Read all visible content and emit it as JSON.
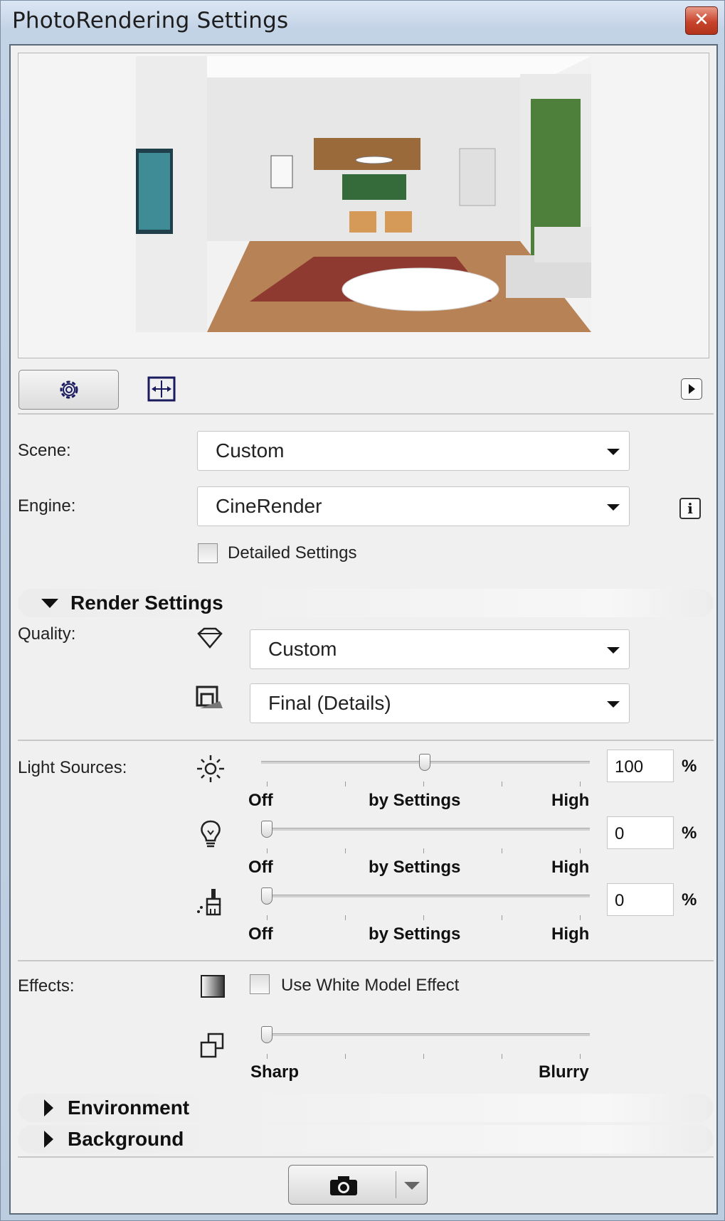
{
  "window": {
    "title": "PhotoRendering Settings",
    "close_icon": "close-icon"
  },
  "toolbar": {
    "settings_tab_icon": "gear-icon",
    "size_tab_icon": "size-dimension-icon",
    "menu_icon": "right-arrow-icon"
  },
  "scene": {
    "label": "Scene:",
    "value": "Custom"
  },
  "engine": {
    "label": "Engine:",
    "value": "CineRender",
    "info_icon": "info-icon"
  },
  "detailed_settings": {
    "label": "Detailed Settings",
    "checked": false
  },
  "render_settings": {
    "header": "Render Settings",
    "quality_label": "Quality:",
    "quality_value": "Custom",
    "detail_value": "Final (Details)"
  },
  "light_sources": {
    "label": "Light Sources:",
    "sliders": [
      {
        "icon": "sun-icon",
        "value": "100",
        "unit": "%",
        "level": 0.5,
        "min_label": "Off",
        "mid_label": "by Settings",
        "max_label": "High"
      },
      {
        "icon": "lightbulb-icon",
        "value": "0",
        "unit": "%",
        "level": 0,
        "min_label": "Off",
        "mid_label": "by Settings",
        "max_label": "High"
      },
      {
        "icon": "brush-icon",
        "value": "0",
        "unit": "%",
        "level": 0,
        "min_label": "Off",
        "mid_label": "by Settings",
        "max_label": "High"
      }
    ]
  },
  "effects": {
    "label": "Effects:",
    "white_model_label": "Use White Model Effect",
    "white_model_checked": false,
    "blur_level": 0,
    "min_label": "Sharp",
    "max_label": "Blurry"
  },
  "environment": {
    "header": "Environment"
  },
  "background": {
    "header": "Background"
  },
  "bottom": {
    "camera_icon": "camera-icon",
    "dropdown_icon": "chevron-down-icon"
  },
  "colors": {
    "panel_bg": "#f0f0f0",
    "title_gradient": "#c3d3e6",
    "close_red": "#c8442c"
  }
}
